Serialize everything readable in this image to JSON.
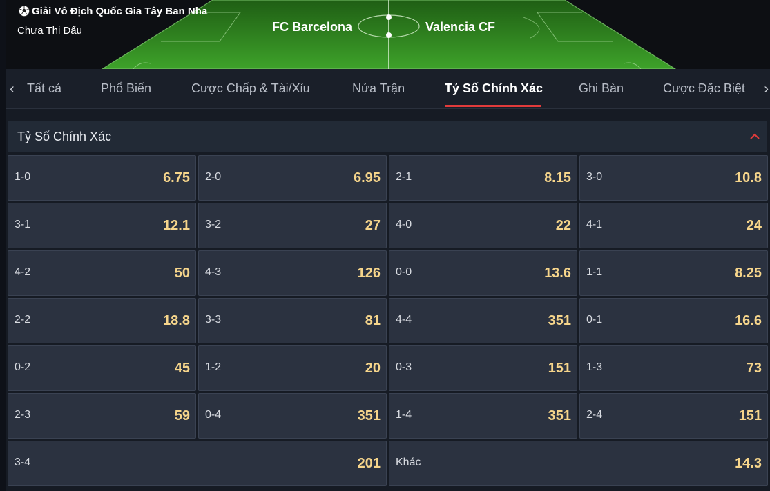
{
  "header": {
    "league": "Giải Vô Địch Quốc Gia Tây Ban Nha",
    "status": "Chưa Thi Đấu",
    "home_team": "FC Barcelona",
    "away_team": "Valencia CF",
    "pitch_color": "#2e8c1f"
  },
  "tabs": {
    "items": [
      {
        "label": "Tất cả"
      },
      {
        "label": "Phổ Biến"
      },
      {
        "label": "Cược Chấp & Tài/Xỉu"
      },
      {
        "label": "Nửa Trận"
      },
      {
        "label": "Tỷ Số Chính Xác"
      },
      {
        "label": "Ghi Bàn"
      },
      {
        "label": "Cược Đặc Biệt"
      }
    ],
    "active_index": 4,
    "active_color": "#e23b3b"
  },
  "section": {
    "title": "Tỷ Số Chính Xác",
    "collapse_icon": "chevron-up-icon"
  },
  "odds": [
    {
      "score": "1-0",
      "odds": "6.75"
    },
    {
      "score": "2-0",
      "odds": "6.95"
    },
    {
      "score": "2-1",
      "odds": "8.15"
    },
    {
      "score": "3-0",
      "odds": "10.8"
    },
    {
      "score": "3-1",
      "odds": "12.1"
    },
    {
      "score": "3-2",
      "odds": "27"
    },
    {
      "score": "4-0",
      "odds": "22"
    },
    {
      "score": "4-1",
      "odds": "24"
    },
    {
      "score": "4-2",
      "odds": "50"
    },
    {
      "score": "4-3",
      "odds": "126"
    },
    {
      "score": "0-0",
      "odds": "13.6"
    },
    {
      "score": "1-1",
      "odds": "8.25"
    },
    {
      "score": "2-2",
      "odds": "18.8"
    },
    {
      "score": "3-3",
      "odds": "81"
    },
    {
      "score": "4-4",
      "odds": "351"
    },
    {
      "score": "0-1",
      "odds": "16.6"
    },
    {
      "score": "0-2",
      "odds": "45"
    },
    {
      "score": "1-2",
      "odds": "20"
    },
    {
      "score": "0-3",
      "odds": "151"
    },
    {
      "score": "1-3",
      "odds": "73"
    },
    {
      "score": "2-3",
      "odds": "59"
    },
    {
      "score": "0-4",
      "odds": "351"
    },
    {
      "score": "1-4",
      "odds": "351"
    },
    {
      "score": "2-4",
      "odds": "151"
    },
    {
      "score": "3-4",
      "odds": "201"
    },
    {
      "score": "Khác",
      "odds": "14.3"
    }
  ],
  "colors": {
    "odds_text": "#f6d58b",
    "cell_bg": "#2b3240"
  }
}
